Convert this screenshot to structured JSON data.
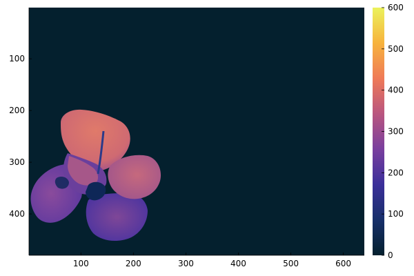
{
  "chart_data": {
    "type": "heatmap",
    "title": "",
    "xlabel": "",
    "ylabel": "",
    "x_range": [
      1,
      640
    ],
    "y_range": [
      1,
      480
    ],
    "y_reversed": true,
    "x_ticks": [
      100,
      200,
      300,
      400,
      500,
      600
    ],
    "y_ticks": [
      100,
      200,
      300,
      400
    ],
    "grid": false,
    "colorbar": {
      "range": [
        0,
        600
      ],
      "ticks": [
        0,
        100,
        200,
        300,
        400,
        500,
        600
      ],
      "colormap": "thermal",
      "stops": [
        "#04202e",
        "#172f6a",
        "#3b2f9a",
        "#7a3f9e",
        "#b9557f",
        "#ef7a57",
        "#f7b33d",
        "#ebf25c"
      ]
    },
    "background_value": 0,
    "background_color": "#04202e",
    "image_content": "flower",
    "regions": [
      {
        "name": "upper-petal",
        "value": 340,
        "color": "#d9706f"
      },
      {
        "name": "right-petal",
        "value": 300,
        "color": "#b75f86"
      },
      {
        "name": "left-petal",
        "value": 230,
        "color": "#7042a5"
      },
      {
        "name": "lower-petal",
        "value": 200,
        "color": "#5b38a3"
      },
      {
        "name": "center-shadow",
        "value": 60,
        "color": "#0e2757"
      }
    ]
  }
}
